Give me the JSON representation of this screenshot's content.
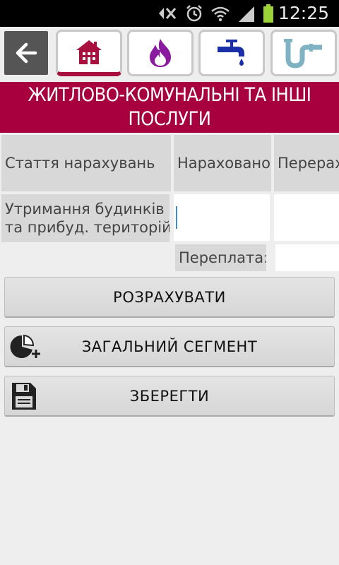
{
  "status_bar": {
    "time": "12:25"
  },
  "tabs": [
    {
      "icon": "house-icon"
    },
    {
      "icon": "flame-icon"
    },
    {
      "icon": "water-tap-icon"
    },
    {
      "icon": "pipe-icon"
    }
  ],
  "title": "ЖИТЛОВО-КОМУНАЛЬНІ ТА ІНШІ ПОСЛУГИ",
  "table": {
    "headers": {
      "article": "Стаття нарахувань",
      "charged": "Нараховано",
      "recalc": "Перерах"
    },
    "row": {
      "label_line1": "Утримання будинків",
      "label_line2": "та прибуд. територій",
      "charged_value": "",
      "recalc_value": ""
    },
    "overpayment": {
      "label": "Переплата:",
      "value": ""
    }
  },
  "buttons": {
    "calculate": "РОЗРАХУВАТИ",
    "general_segment": "ЗАГАЛЬНИЙ СЕГМЕНТ",
    "save": "ЗБЕРЕГТИ"
  },
  "colors": {
    "accent": "#a8003e",
    "tab_active_underline": "#a8103e"
  }
}
